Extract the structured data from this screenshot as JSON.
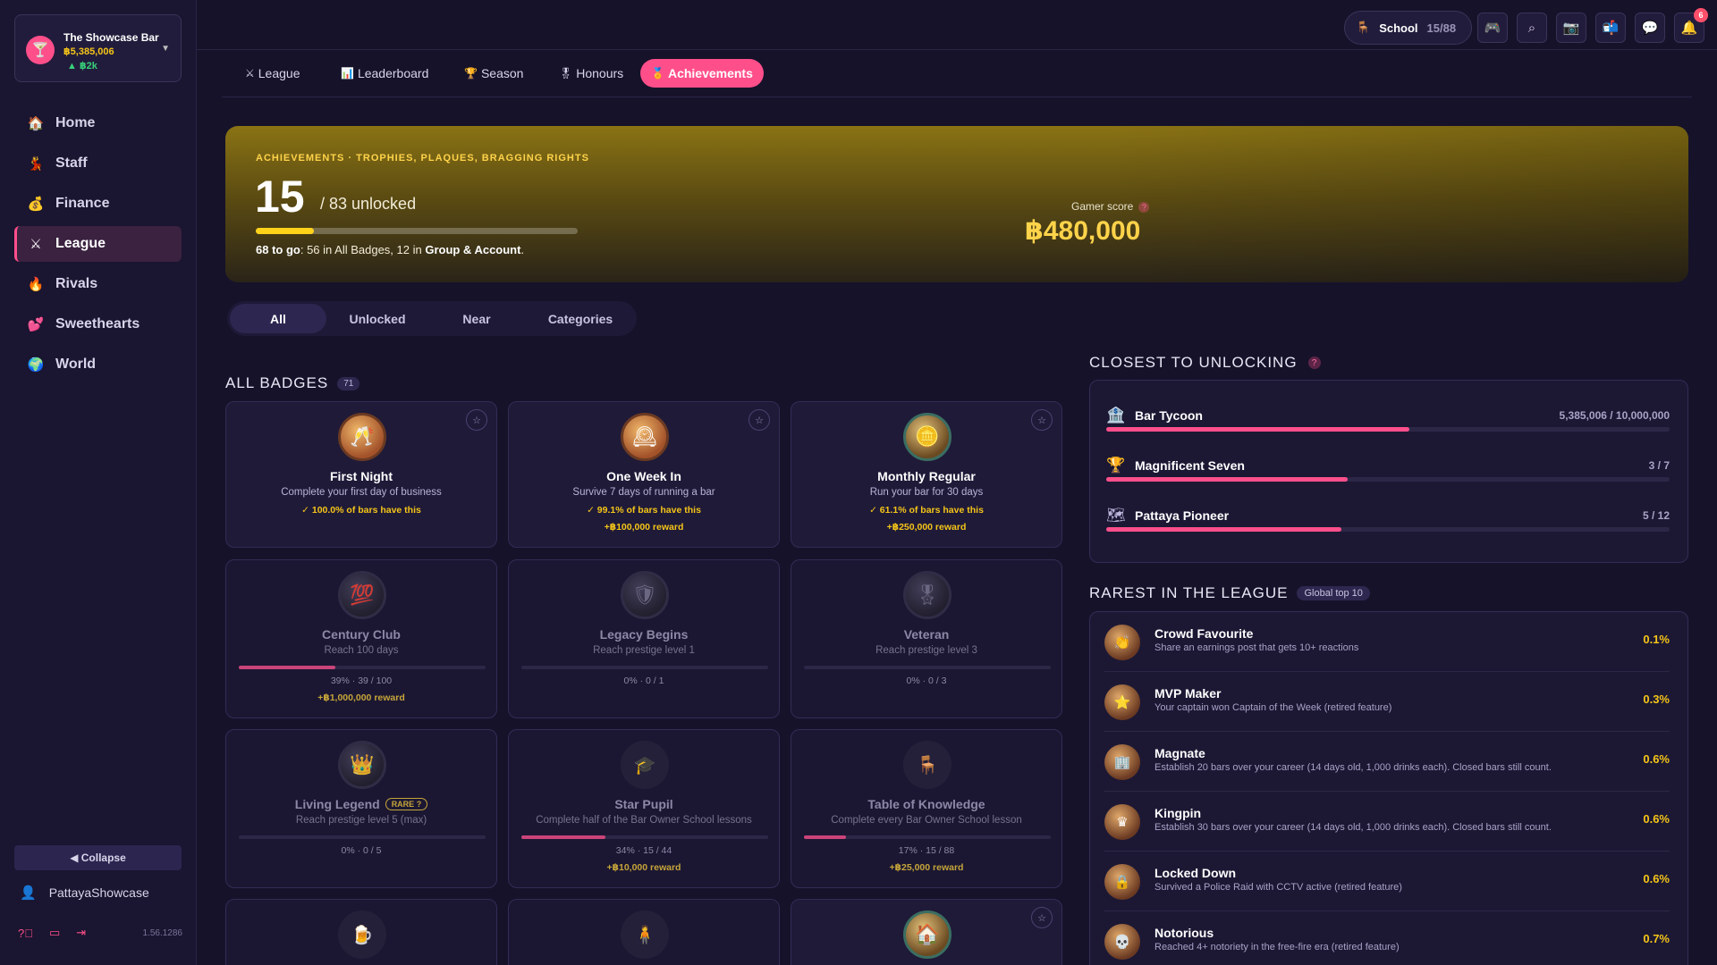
{
  "bar": {
    "name": "The Showcase Bar",
    "money": "฿5,385,006",
    "delta": "▲ ฿2k"
  },
  "nav": [
    {
      "icon": "🏠",
      "label": "Home"
    },
    {
      "icon": "💃",
      "label": "Staff"
    },
    {
      "icon": "💰",
      "label": "Finance"
    },
    {
      "icon": "⚔",
      "label": "League"
    },
    {
      "icon": "🔥",
      "label": "Rivals"
    },
    {
      "icon": "💕",
      "label": "Sweethearts"
    },
    {
      "icon": "🌍",
      "label": "World"
    }
  ],
  "sidebar_footer": {
    "collapse": "◀ Collapse",
    "username": "PattayaShowcase",
    "version": "1.56.1286"
  },
  "topbar": {
    "school_label": "School",
    "school_count": "15/88",
    "notif_count": "6"
  },
  "tabs": [
    {
      "icon": "⚔",
      "label": "League"
    },
    {
      "icon": "📊",
      "label": "Leaderboard"
    },
    {
      "icon": "🏆",
      "label": "Season"
    },
    {
      "icon": "🎖",
      "label": "Honours"
    },
    {
      "icon": "🏅",
      "label": "Achievements"
    }
  ],
  "hero": {
    "kicker": "ACHIEVEMENTS · TROPHIES, PLAQUES, BRAGGING RIGHTS",
    "unlocked": "15",
    "total": "/ 83 unlocked",
    "progress": 0.18,
    "sub_prefix": "68 to go",
    "sub_mid": ": 56 in All Badges, 12 in ",
    "sub_group": "Group & Account",
    "sub_end": ".",
    "gamer_score_label": "Gamer score",
    "gamer_score": "฿480,000"
  },
  "filters": [
    "All",
    "Unlocked",
    "Near",
    "Categories"
  ],
  "all_badges": {
    "title": "ALL BADGES",
    "count": "71"
  },
  "badges": [
    {
      "name": "First Night",
      "desc": "Complete your first day of business",
      "owned": "✓ 100.0% of bars have this",
      "reward": ""
    },
    {
      "name": "One Week In",
      "desc": "Survive 7 days of running a bar",
      "owned": "✓ 99.1% of bars have this",
      "reward": "+฿100,000 reward"
    },
    {
      "name": "Monthly Regular",
      "desc": "Run your bar for 30 days",
      "owned": "✓ 61.1% of bars have this",
      "reward": "+฿250,000 reward"
    },
    {
      "name": "Century Club",
      "desc": "Reach 100 days",
      "progress": 0.39,
      "progress_text": "39% · 39 / 100",
      "reward": "+฿1,000,000 reward"
    },
    {
      "name": "Legacy Begins",
      "desc": "Reach prestige level 1",
      "progress": 0,
      "progress_text": "0% · 0 / 1",
      "reward": ""
    },
    {
      "name": "Veteran",
      "desc": "Reach prestige level 3",
      "progress": 0,
      "progress_text": "0% · 0 / 3",
      "reward": ""
    },
    {
      "name": "Living Legend",
      "rare": "RARE ?",
      "desc": "Reach prestige level 5 (max)",
      "progress": 0,
      "progress_text": "0% · 0 / 5",
      "reward": ""
    },
    {
      "name": "Star Pupil",
      "desc": "Complete half of the Bar Owner School lessons",
      "progress": 0.34,
      "progress_text": "34% · 15 / 44",
      "reward": "+฿10,000 reward"
    },
    {
      "name": "Table of Knowledge",
      "desc": "Complete every Bar Owner School lesson",
      "progress": 0.17,
      "progress_text": "17% · 15 / 88",
      "reward": "+฿25,000 reward"
    }
  ],
  "closest": {
    "title": "CLOSEST TO UNLOCKING",
    "items": [
      {
        "icon": "🏦",
        "name": "Bar Tycoon",
        "value": "5,385,006 / 10,000,000",
        "progress": 0.5385
      },
      {
        "icon": "🏆",
        "name": "Magnificent Seven",
        "value": "3 / 7",
        "progress": 0.4286
      },
      {
        "icon": "🗺",
        "name": "Pattaya Pioneer",
        "value": "5 / 12",
        "progress": 0.4167
      }
    ]
  },
  "rarest": {
    "title": "RAREST IN THE LEAGUE",
    "tag": "Global top 10",
    "items": [
      {
        "name": "Crowd Favourite",
        "desc": "Share an earnings post that gets 10+ reactions",
        "pct": "0.1%"
      },
      {
        "name": "MVP Maker",
        "desc": "Your captain won Captain of the Week (retired feature)",
        "pct": "0.3%"
      },
      {
        "name": "Magnate",
        "desc": "Establish 20 bars over your career (14 days old, 1,000 drinks each). Closed bars still count.",
        "pct": "0.6%"
      },
      {
        "name": "Kingpin",
        "desc": "Establish 30 bars over your career (14 days old, 1,000 drinks each). Closed bars still count.",
        "pct": "0.6%"
      },
      {
        "name": "Locked Down",
        "desc": "Survived a Police Raid with CCTV active (retired feature)",
        "pct": "0.6%"
      },
      {
        "name": "Notorious",
        "desc": "Reached 4+ notoriety in the free-fire era (retired feature)",
        "pct": "0.7%"
      }
    ]
  }
}
